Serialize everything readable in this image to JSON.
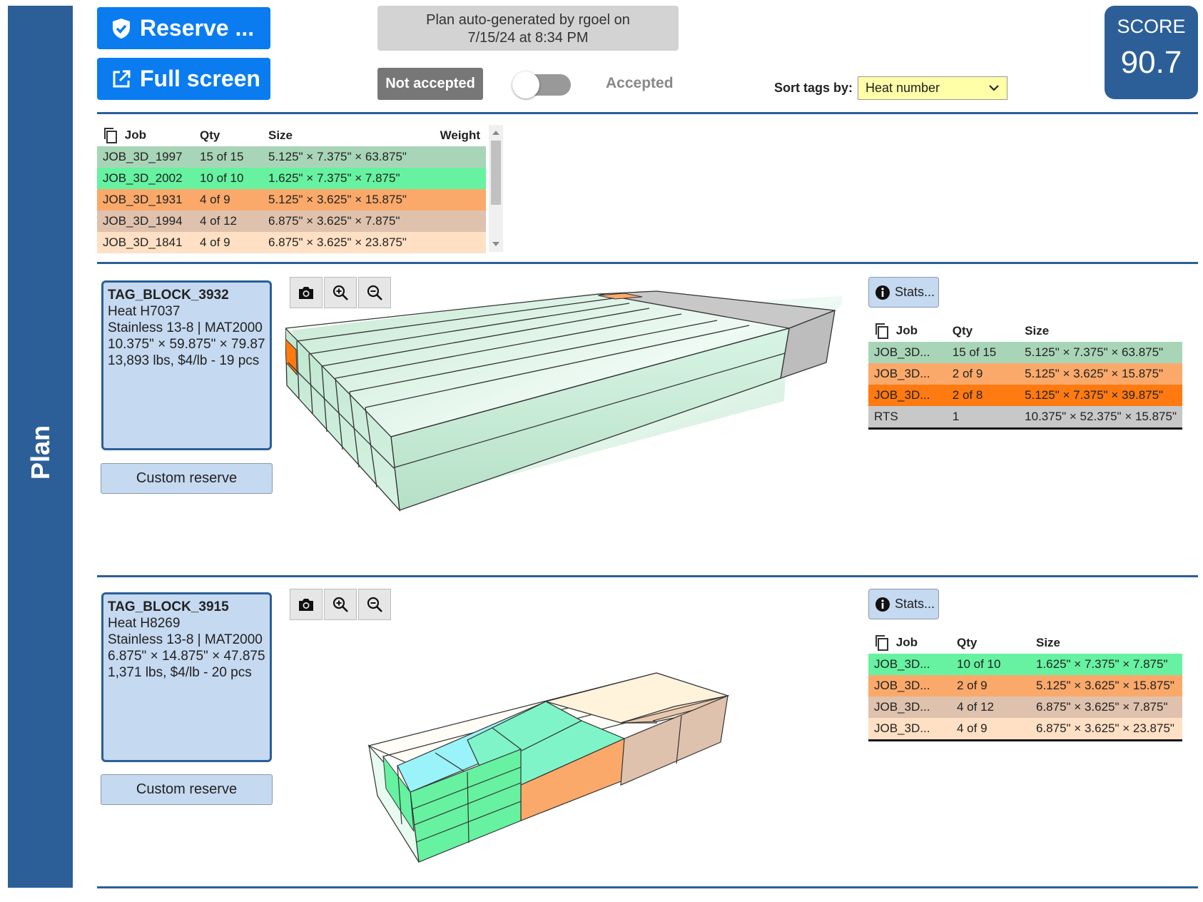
{
  "sidebar": {
    "label": "Plan"
  },
  "toolbar": {
    "reserve_label": "Reserve ...",
    "fullscreen_label": "Full screen",
    "plan_info_line1": "Plan auto-generated by rgoel on",
    "plan_info_line2": "7/15/24 at 8:34 PM",
    "not_accepted_label": "Not accepted",
    "accepted_label": "Accepted",
    "toggle_on": false,
    "sort_label": "Sort tags by:",
    "sort_value": "Heat number"
  },
  "score": {
    "label": "SCORE",
    "value": "90.7"
  },
  "summary_table": {
    "headers": [
      "Job",
      "Qty",
      "Size",
      "Weight"
    ],
    "rows": [
      {
        "job": "JOB_3D_1997",
        "qty": "15 of 15",
        "size": "5.125\" × 7.375\" × 63.875\"",
        "weight": "",
        "color": "#a8d5b8"
      },
      {
        "job": "JOB_3D_2002",
        "qty": "10 of 10",
        "size": "1.625\" × 7.375\" × 7.875\"",
        "weight": "",
        "color": "#66f2a0"
      },
      {
        "job": "JOB_3D_1931",
        "qty": "4 of 9",
        "size": "5.125\" × 3.625\" × 15.875\"",
        "weight": "",
        "color": "#fba96a"
      },
      {
        "job": "JOB_3D_1994",
        "qty": "4 of 12",
        "size": "6.875\" × 3.625\" × 7.875\"",
        "weight": "",
        "color": "#dfc2ad"
      },
      {
        "job": "JOB_3D_1841",
        "qty": "4 of 9",
        "size": "6.875\" × 3.625\" × 23.875\"",
        "weight": "",
        "color": "#ffe0c4"
      }
    ]
  },
  "blocks": [
    {
      "tag": "TAG_BLOCK_3932",
      "heat": "Heat H7037",
      "material": "Stainless 13-8 | MAT2000",
      "dims": "10.375\" × 59.875\" × 79.87",
      "weight_info": "13,893 lbs, $4/lb - 19 pcs",
      "custom_reserve_label": "Custom reserve",
      "stats_label": "Stats...",
      "headers": [
        "Job",
        "Qty",
        "Size"
      ],
      "rows": [
        {
          "job": "JOB_3D...",
          "qty": "15 of 15",
          "size": "5.125\" × 7.375\" × 63.875\"",
          "color": "#a8d5b8"
        },
        {
          "job": "JOB_3D...",
          "qty": "2 of 9",
          "size": "5.125\" × 3.625\" × 15.875\"",
          "color": "#fba96a"
        },
        {
          "job": "JOB_3D...",
          "qty": "2 of 8",
          "size": "5.125\" × 7.375\" × 39.875\"",
          "color": "#ff7a10"
        },
        {
          "job": "RTS",
          "qty": "1",
          "size": "10.375\" × 52.375\" × 15.875\"",
          "color": "#c8c8c8"
        }
      ]
    },
    {
      "tag": "TAG_BLOCK_3915",
      "heat": "Heat H8269",
      "material": "Stainless 13-8 | MAT2000",
      "dims": "6.875\" × 14.875\" × 47.875",
      "weight_info": "1,371 lbs, $4/lb - 20 pcs",
      "custom_reserve_label": "Custom reserve",
      "stats_label": "Stats...",
      "headers": [
        "Job",
        "Qty",
        "Size"
      ],
      "rows": [
        {
          "job": "JOB_3D...",
          "qty": "10 of 10",
          "size": "1.625\" × 7.375\" × 7.875\"",
          "color": "#66f2a0"
        },
        {
          "job": "JOB_3D...",
          "qty": "2 of 9",
          "size": "5.125\" × 3.625\" × 15.875\"",
          "color": "#fba96a"
        },
        {
          "job": "JOB_3D...",
          "qty": "4 of 12",
          "size": "6.875\" × 3.625\" × 7.875\"",
          "color": "#dfc2ad"
        },
        {
          "job": "JOB_3D...",
          "qty": "4 of 9",
          "size": "6.875\" × 3.625\" × 23.875\"",
          "color": "#ffe0c4"
        }
      ]
    }
  ],
  "icons": {
    "reserve": "shield-check-icon",
    "fullscreen": "external-link-icon",
    "camera": "camera-icon",
    "zoom_in": "zoom-in-icon",
    "zoom_out": "zoom-out-icon",
    "info": "info-icon",
    "copy": "copy-icon"
  }
}
